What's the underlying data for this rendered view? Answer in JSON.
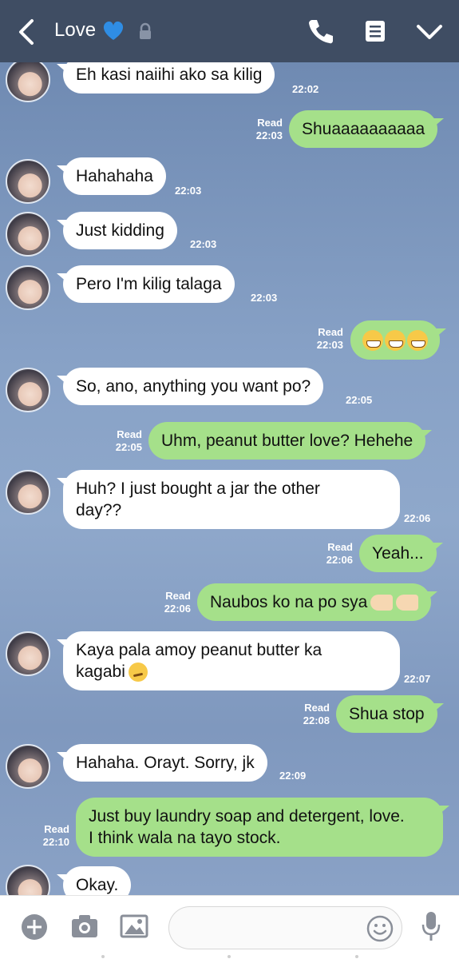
{
  "header": {
    "title": "Love",
    "icons": [
      "back-arrow-icon",
      "blue-heart-icon",
      "lock-icon",
      "phone-icon",
      "note-icon",
      "chevron-down-icon"
    ]
  },
  "messages": [
    {
      "dir": "in",
      "text": "Eh kasi naiihi ako sa kilig",
      "time": "22:02"
    },
    {
      "dir": "out",
      "text": "Shuaaaaaaaaaa",
      "read": "Read",
      "time": "22:03"
    },
    {
      "dir": "in",
      "text": "Hahahaha",
      "time": "22:03"
    },
    {
      "dir": "in",
      "text": "Just kidding",
      "time": "22:03"
    },
    {
      "dir": "in",
      "text": "Pero I'm kilig talaga",
      "time": "22:03"
    },
    {
      "dir": "out",
      "text": "",
      "emoji": "grinning-face-x3",
      "read": "Read",
      "time": "22:03"
    },
    {
      "dir": "in",
      "text": "So, ano, anything you want po?",
      "time": "22:05"
    },
    {
      "dir": "out",
      "text": "Uhm, peanut butter love? Hehehe",
      "read": "Read",
      "time": "22:05"
    },
    {
      "dir": "in",
      "line1": "Huh? I just bought a jar the other",
      "line2": "day??",
      "time": "22:06"
    },
    {
      "dir": "out",
      "text": "Yeah...",
      "read": "Read",
      "time": "22:06"
    },
    {
      "dir": "out",
      "text": "Naubos ko na po sya",
      "emoji": "pointing-hands",
      "read": "Read",
      "time": "22:06"
    },
    {
      "dir": "in",
      "line1": "Kaya pala amoy peanut butter ka",
      "line2": "kagabi",
      "emoji": "smirking-face",
      "time": "22:07"
    },
    {
      "dir": "out",
      "text": "Shua stop",
      "read": "Read",
      "time": "22:08"
    },
    {
      "dir": "in",
      "text": "Hahaha. Orayt. Sorry, jk",
      "time": "22:09"
    },
    {
      "dir": "out",
      "line1": "Just buy laundry soap and detergent, love.",
      "line2": "I think wala na tayo stock.",
      "read": "Read",
      "time": "22:10"
    },
    {
      "dir": "in",
      "text": "Okay.",
      "time": ""
    }
  ],
  "footer": {
    "icons": [
      "plus-icon",
      "camera-icon",
      "image-icon",
      "emoji-icon",
      "microphone-icon"
    ]
  },
  "colors": {
    "header": "#3f4d63",
    "incoming": "#ffffff",
    "outgoing": "#a5e08a",
    "background": "#7f9bc4"
  }
}
